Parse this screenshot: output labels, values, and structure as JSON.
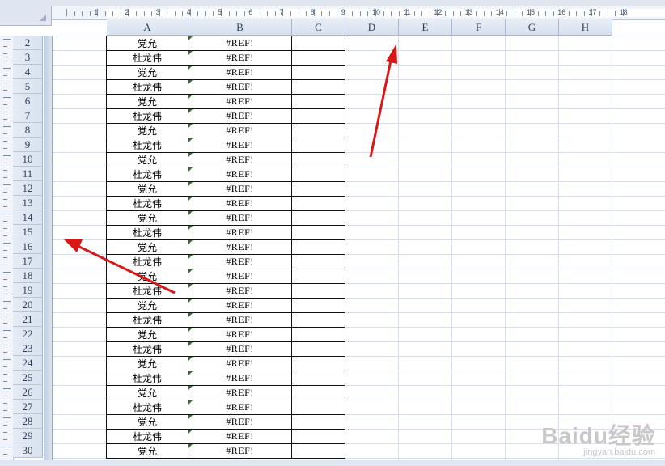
{
  "ruler": {
    "numbers": [
      "1",
      "2",
      "3",
      "4",
      "5",
      "6",
      "7",
      "8",
      "9",
      "10",
      "11",
      "12",
      "13",
      "14",
      "15",
      "16",
      "17",
      "18"
    ]
  },
  "columns": [
    "A",
    "B",
    "C",
    "D",
    "E",
    "F",
    "G",
    "H"
  ],
  "rows": [
    {
      "n": "2",
      "a": "党允",
      "b": "#REF!"
    },
    {
      "n": "3",
      "a": "杜龙伟",
      "b": "#REF!"
    },
    {
      "n": "4",
      "a": "党允",
      "b": "#REF!"
    },
    {
      "n": "5",
      "a": "杜龙伟",
      "b": "#REF!"
    },
    {
      "n": "6",
      "a": "党允",
      "b": "#REF!"
    },
    {
      "n": "7",
      "a": "杜龙伟",
      "b": "#REF!"
    },
    {
      "n": "8",
      "a": "党允",
      "b": "#REF!"
    },
    {
      "n": "9",
      "a": "杜龙伟",
      "b": "#REF!"
    },
    {
      "n": "10",
      "a": "党允",
      "b": "#REF!"
    },
    {
      "n": "11",
      "a": "杜龙伟",
      "b": "#REF!"
    },
    {
      "n": "12",
      "a": "党允",
      "b": "#REF!"
    },
    {
      "n": "13",
      "a": "杜龙伟",
      "b": "#REF!"
    },
    {
      "n": "14",
      "a": "党允",
      "b": "#REF!"
    },
    {
      "n": "15",
      "a": "杜龙伟",
      "b": "#REF!"
    },
    {
      "n": "16",
      "a": "党允",
      "b": "#REF!"
    },
    {
      "n": "17",
      "a": "杜龙伟",
      "b": "#REF!"
    },
    {
      "n": "18",
      "a": "党允",
      "b": "#REF!"
    },
    {
      "n": "19",
      "a": "杜龙伟",
      "b": "#REF!"
    },
    {
      "n": "20",
      "a": "党允",
      "b": "#REF!"
    },
    {
      "n": "21",
      "a": "杜龙伟",
      "b": "#REF!"
    },
    {
      "n": "22",
      "a": "党允",
      "b": "#REF!"
    },
    {
      "n": "23",
      "a": "杜龙伟",
      "b": "#REF!"
    },
    {
      "n": "24",
      "a": "党允",
      "b": "#REF!"
    },
    {
      "n": "25",
      "a": "杜龙伟",
      "b": "#REF!"
    },
    {
      "n": "26",
      "a": "党允",
      "b": "#REF!"
    },
    {
      "n": "27",
      "a": "杜龙伟",
      "b": "#REF!"
    },
    {
      "n": "28",
      "a": "党允",
      "b": "#REF!"
    },
    {
      "n": "29",
      "a": "杜龙伟",
      "b": "#REF!"
    },
    {
      "n": "30",
      "a": "党允",
      "b": "#REF!"
    }
  ],
  "watermark": {
    "brand": "Baidu经验",
    "url": "jingyan.baidu.com"
  },
  "colors": {
    "arrow": "#e02020",
    "error_flag": "#1f7a2c",
    "header_bg": "#dfe6f1"
  }
}
